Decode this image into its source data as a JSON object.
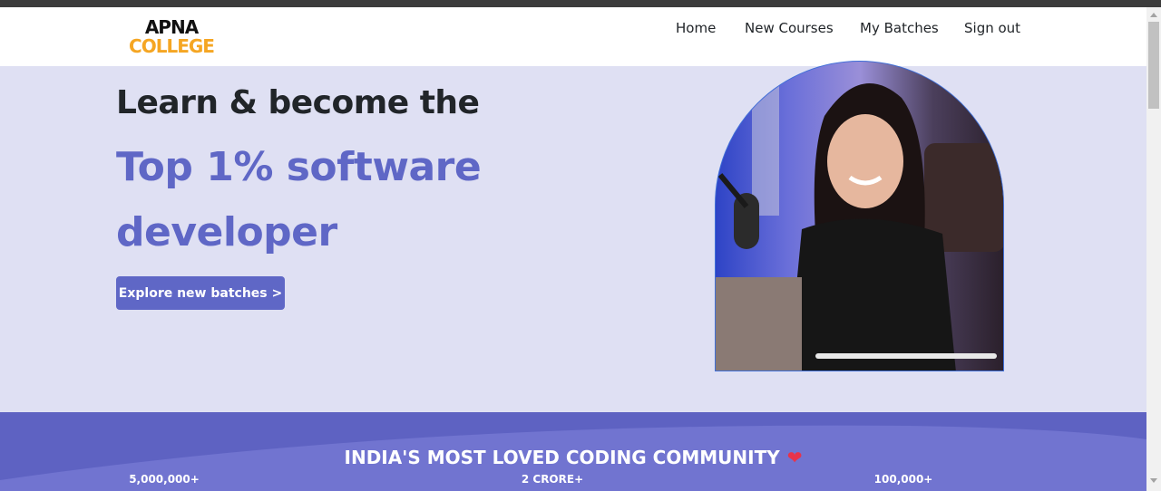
{
  "brand": {
    "logo_top": "APNA",
    "logo_bottom": "COLLEGE",
    "logo_top_color": "#111111",
    "logo_bottom_color": "#f5a623"
  },
  "nav": {
    "items": [
      {
        "label": "Home"
      },
      {
        "label": "New Courses"
      },
      {
        "label": "My Batches"
      },
      {
        "label": "Sign out"
      }
    ]
  },
  "hero": {
    "line1": "Learn & become the",
    "line2": "Top 1% software",
    "line3": "developer",
    "cta_label": "Explore new batches >",
    "accent_color": "#5f67c6",
    "background_color": "#dfe0f3"
  },
  "community": {
    "title": "INDIA'S MOST LOVED CODING COMMUNITY",
    "heart_icon": "heart-icon",
    "stats": [
      {
        "value": "5,000,000+"
      },
      {
        "value": "2 CRORE+"
      },
      {
        "value": "100,000+"
      }
    ],
    "background_color": "#5e62c2"
  }
}
